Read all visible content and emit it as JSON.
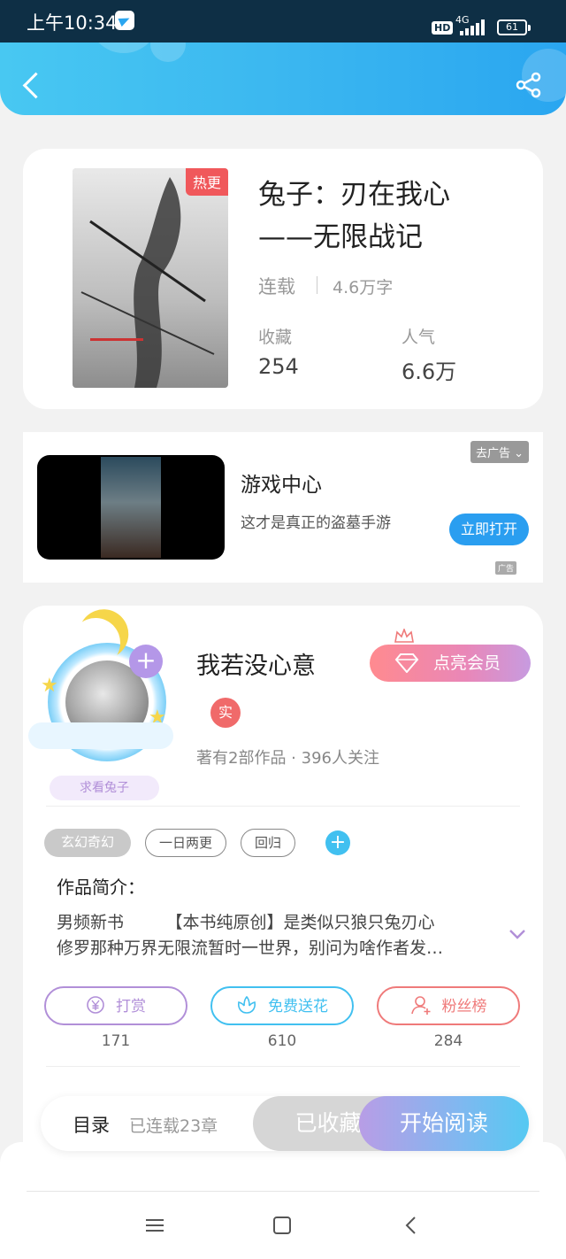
{
  "status_bar": {
    "time": "上午10:34",
    "hd": "HD",
    "network": "4G",
    "battery": "61"
  },
  "header": {
    "back_icon": "chevron-left-icon",
    "share_icon": "share-icon"
  },
  "book": {
    "hot_tag": "热更",
    "title_line1": "兔子：刃在我心",
    "title_line2": "——无限战记",
    "status": "连载",
    "words": "4.6万字",
    "collect_label": "收藏",
    "collect_value": "254",
    "popularity_label": "人气",
    "popularity_value": "6.6万"
  },
  "ad": {
    "title": "游戏中心",
    "description": "这才是真正的盗墓手游",
    "close_label": "去广告",
    "open_label": "立即打开",
    "ad_mark": "广告"
  },
  "author": {
    "name": "我若没心意",
    "real_badge": "实",
    "stats": "著有2部作品 · 396人关注",
    "beg_label": "求看兔子",
    "vip_label": "点亮会员",
    "add_symbol": "+"
  },
  "tags": [
    {
      "label": "玄幻奇幻"
    },
    {
      "label": "一日两更"
    },
    {
      "label": "回归"
    }
  ],
  "tag_add_symbol": "+",
  "intro": {
    "heading": "作品简介：",
    "line1": "男频新书　　　【本书纯原创】是类似只狼只兔刃心",
    "line2": "修罗那种万界无限流暂时一世界，别问为啥作者发…"
  },
  "actions": [
    {
      "label": "打赏",
      "icon": "yen",
      "count": "171",
      "color": "#b18fd8"
    },
    {
      "label": "免费送花",
      "icon": "flower",
      "count": "610",
      "color": "#41c0f0"
    },
    {
      "label": "粉丝榜",
      "icon": "user",
      "count": "284",
      "color": "#ef7a7a"
    }
  ],
  "read_bar": {
    "toc_label": "目录",
    "toc_sub": "已连载23章",
    "collected_label": "已收藏",
    "start_label": "开始阅读"
  },
  "nav": {
    "menu_icon": "menu-icon",
    "home_icon": "home-icon",
    "back_icon": "back-icon"
  },
  "colors": {
    "header_blue": "#3bb7f0",
    "accent_pink": "#f0585b"
  }
}
